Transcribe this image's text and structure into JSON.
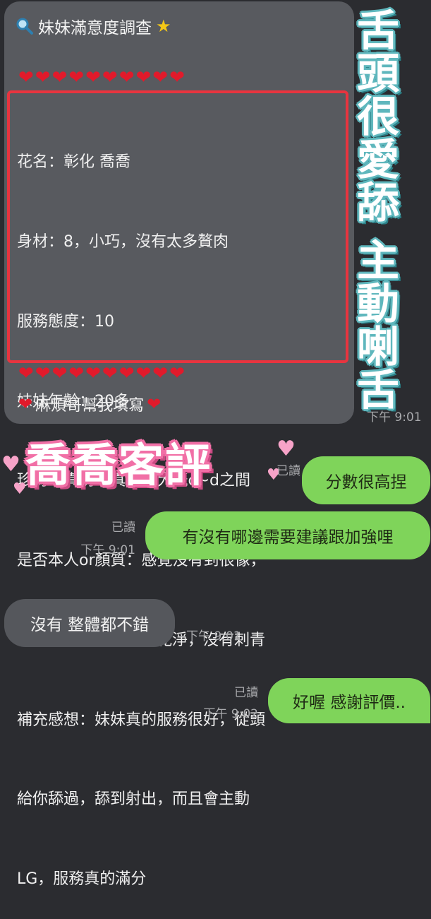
{
  "survey": {
    "title": "妹妹滿意度調查",
    "star": "★",
    "hearts_top": "❤❤❤❤❤❤❤❤❤❤",
    "hearts_bottom": "❤❤❤❤❤❤❤❤❤❤",
    "lines": [
      "花名：彰化 喬喬",
      "身材：8，小巧，沒有太多贅肉",
      "服務態度：10",
      "妹妹年齡：20多",
      "珍奶or真奶：真奶，大概c~d之間",
      "是否本人or顏質：感覺沒有到很像，",
      "但也還行，皮膚白皙乾淨，沒有刺青",
      "補充感想：妹妹真的服務很好，從頭",
      "給你舔過，舔到射出，而且會主動",
      "LG，服務真的滿分"
    ],
    "closing_heart": "❤",
    "closing": "麻煩哥幫我填寫"
  },
  "overlay": {
    "vertical_1": [
      "舌",
      "頭",
      "很",
      "愛",
      "舔"
    ],
    "vertical_2": [
      "主",
      "動",
      "喇",
      "舌"
    ],
    "sticker_title": "喬喬客評"
  },
  "messages": [
    {
      "side": "in_time",
      "time": "下午 9:01"
    },
    {
      "side": "out",
      "text": "分數很高捏",
      "read": "已讀"
    },
    {
      "side": "out",
      "text": "有沒有哪邊需要建議跟加強哩",
      "read": "已讀",
      "time": "下午 9:01"
    },
    {
      "side": "in",
      "text": "沒有 整體都不錯",
      "time": "下午 9:01"
    },
    {
      "side": "out",
      "text": "好喔 感謝評價..",
      "read": "已讀",
      "time": "下午 9:02"
    }
  ],
  "colors": {
    "background": "#2b2c30",
    "incoming_bubble": "#585a5f",
    "outgoing_bubble": "#7fd45a",
    "highlight_box": "#e8343f",
    "heart": "#e11a2b",
    "overlay_outline": "#5fb7bd",
    "sticker_outline": "#f16fa6"
  }
}
